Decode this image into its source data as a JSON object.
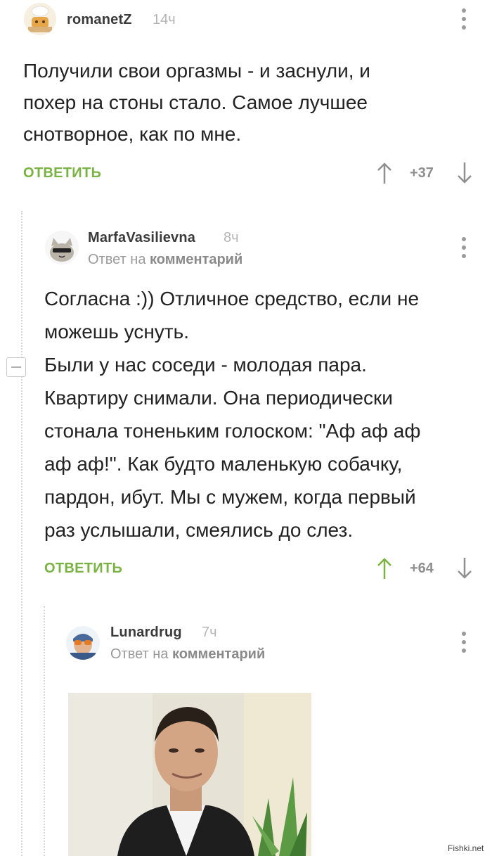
{
  "comments": [
    {
      "username": "romanetZ",
      "time": "14ч",
      "text": [
        "Получили свои оргазмы - и заснули, и",
        "похер на стоны стало. Самое лучшее",
        "снотворное, как по мне."
      ],
      "reply_label": "ОТВЕТИТЬ",
      "rating": "+37",
      "avatar_icon": "cat-chef-avatar-icon"
    },
    {
      "username": "MarfaVasilievna",
      "time": "8ч",
      "reply_prefix": "Ответ на",
      "reply_target": "комментарий",
      "text": [
        "Согласна :)) Отличное средство, если не",
        "можешь уснуть.",
        "Были у нас соседи - молодая пара.",
        "Квартиру снимали. Она периодически",
        "стонала тоненьким голоском: \"Аф аф аф",
        "аф аф!\". Как будто маленькую собачку,",
        "пардон, ибут. Мы с мужем, когда первый",
        "раз услышали, смеялись до слез."
      ],
      "reply_label": "ОТВЕТИТЬ",
      "rating": "+64",
      "avatar_icon": "pusheen-cat-avatar-icon"
    },
    {
      "username": "Lunardrug",
      "time": "7ч",
      "reply_prefix": "Ответ на",
      "reply_target": "комментарий",
      "avatar_icon": "goggles-avatar-icon"
    }
  ],
  "watermark": "Fishki.net",
  "colors": {
    "accent_green": "#7ab344",
    "text": "#222222",
    "muted": "#9a9a9a"
  }
}
